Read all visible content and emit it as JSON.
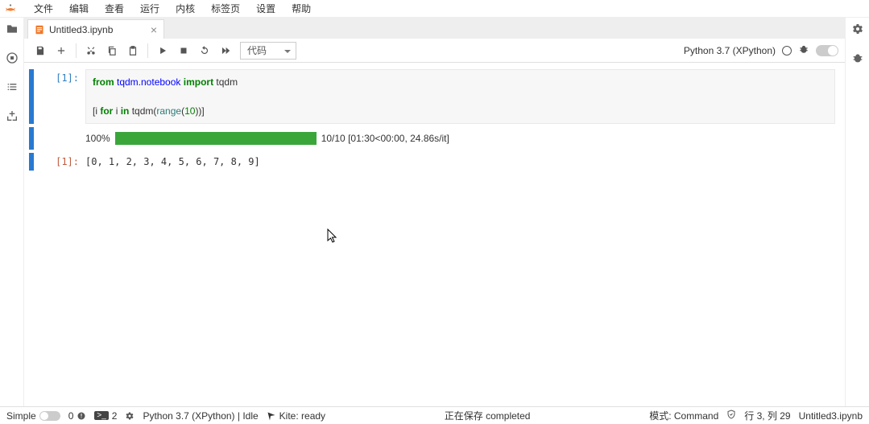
{
  "menu": {
    "items": [
      "文件",
      "编辑",
      "查看",
      "运行",
      "内核",
      "标签页",
      "设置",
      "帮助"
    ]
  },
  "tab": {
    "title": "Untitled3.ipynb"
  },
  "toolbar": {
    "celltype": "代码",
    "kernel": "Python 3.7 (XPython)"
  },
  "cell": {
    "in_prompt": "[1]:",
    "code_tokens": [
      {
        "t": "from ",
        "c": "kw-green"
      },
      {
        "t": "tqdm.notebook ",
        "c": "kw-blue"
      },
      {
        "t": "import ",
        "c": "kw-green"
      },
      {
        "t": "tqdm",
        "c": ""
      },
      {
        "t": "\n\n",
        "c": ""
      },
      {
        "t": "[i ",
        "c": ""
      },
      {
        "t": "for ",
        "c": "kw-green"
      },
      {
        "t": "i ",
        "c": ""
      },
      {
        "t": "in ",
        "c": "kw-green"
      },
      {
        "t": "tqdm(",
        "c": ""
      },
      {
        "t": "range",
        "c": "fn-teal"
      },
      {
        "t": "(",
        "c": ""
      },
      {
        "t": "10",
        "c": "num"
      },
      {
        "t": "))]",
        "c": ""
      }
    ],
    "progress": {
      "pct": "100%",
      "label": "10/10 [01:30<00:00, 24.86s/it]"
    },
    "out_prompt": "[1]:",
    "out_text": "[0, 1, 2, 3, 4, 5, 6, 7, 8, 9]"
  },
  "status": {
    "simple": "Simple",
    "zero": "0",
    "terms": "2",
    "kernel": "Python 3.7 (XPython) | Idle",
    "kite": "Kite: ready",
    "saving": "正在保存 completed",
    "mode": "模式: Command",
    "pos": "行 3, 列 29",
    "file": "Untitled3.ipynb"
  }
}
